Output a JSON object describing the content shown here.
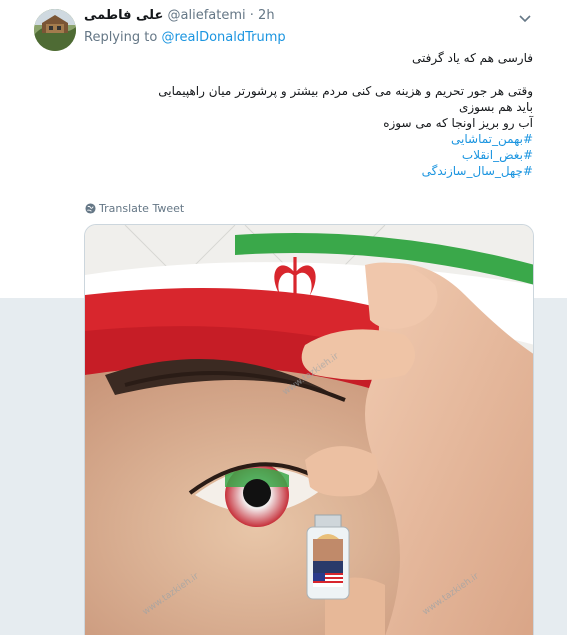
{
  "tweet": {
    "display_name": "علی فاطمی",
    "handle": "@aliefatemi",
    "separator": "·",
    "time": "2h",
    "replying_prefix": "Replying to",
    "replying_to": "@realDonaldTrump",
    "lines": [
      "فارسی هم که یاد گرفتی",
      "وقتی هر جور تحریم و هزینه می کنی مردم بیشتر و پرشورتر میان راهپیمایی",
      "باید هم بسوزی",
      "آب رو بریز اونجا که می سوزه"
    ],
    "hashtags": [
      "#بهمن_تماشایی",
      "#بغض_انقلاب",
      "#چهل_سال_سازندگی"
    ],
    "translate_label": "Translate Tweet"
  },
  "icons": {
    "more": "chevron-down-icon",
    "translate": "globe-icon"
  },
  "colors": {
    "link": "#1b95e0",
    "secondary_text": "#657786",
    "flag_green": "#3aa84a",
    "flag_red": "#d8262d"
  },
  "image": {
    "watermark": "www.tazkieh.ir"
  }
}
